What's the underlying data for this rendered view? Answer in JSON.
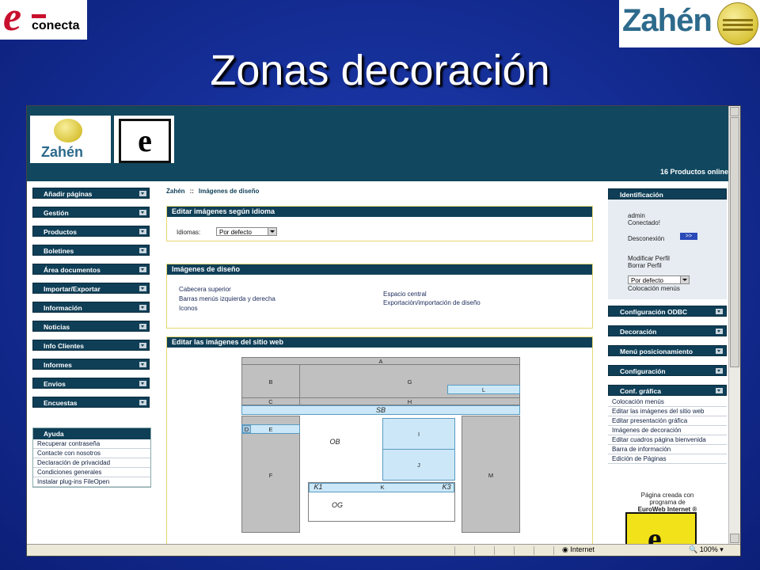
{
  "slide": {
    "title": "Zonas decoración",
    "logo_left_text": "conecta",
    "logo_left_letter": "e",
    "logo_right_text": "Zahén"
  },
  "header": {
    "logo_text": "Zahén",
    "logo2_letter": "e",
    "online_status": "16 Productos online"
  },
  "left_nav": {
    "items": [
      "Añadir páginas",
      "Gestión",
      "Productos",
      "Boletines",
      "Área documentos",
      "Importar/Exportar",
      "Información",
      "Noticias",
      "Info Clientes",
      "Informes",
      "Envios",
      "Encuestas"
    ],
    "help_title": "Ayuda",
    "help_links": [
      "Recuperar contraseña",
      "Contacte con nosotros",
      "Declaración de privacidad",
      "Condiciones generales",
      "Instalar plug-ins FileOpen"
    ]
  },
  "breadcrumb": {
    "root": "Zahén",
    "sep": "::",
    "current": "Imágenes de diseño"
  },
  "panel_language": {
    "title": "Editar imágenes según idioma",
    "label": "Idiomas:",
    "select_value": "Por defecto"
  },
  "panel_design": {
    "title": "Imágenes de diseño",
    "links_left": [
      "Cabecera superior",
      "Barras menús izquierda y derecha",
      "Iconos"
    ],
    "links_right": [
      "Espacio central",
      "Exportación/importación de diseño"
    ]
  },
  "panel_site": {
    "title": "Editar las imágenes del sitio web",
    "zones": {
      "A": "A",
      "B": "B",
      "G": "G",
      "L": "L",
      "C": "C",
      "H": "H",
      "SB": "SB",
      "D": "D",
      "E": "E",
      "OB": "OB",
      "I": "I",
      "J": "J",
      "F": "F",
      "M": "M",
      "K1": "K1",
      "K": "K",
      "K3": "K3",
      "OG": "OG"
    }
  },
  "right_col": {
    "ident_title": "Identificación",
    "user": "admin",
    "status": "Conectado!",
    "logout": "Desconexión",
    "logout_btn": ">>",
    "modify_profile": "Modificar Perfil",
    "delete_profile": "Borrar Perfil",
    "select_value": "Por defecto",
    "menu_placement": "Colocación menús",
    "bars": [
      "Configuración ODBC",
      "Decoración",
      "Menú posicionamiento",
      "Configuración",
      "Conf. gráfica"
    ],
    "conf_links": [
      "Colocación menús",
      "Editar las imágenes del sitio web",
      "Editar presentación gráfica",
      "Imágenes de decoración",
      "Editar cuadros página bienvenida",
      "Barra de información",
      "Edición de Páginas"
    ],
    "credit_line1": "Página creada con",
    "credit_line2": "programa de",
    "credit_line3": "EuroWeb Internet ®",
    "logo_letter": "e"
  },
  "statusbar": {
    "zone": "Internet",
    "zoom": "100%"
  }
}
